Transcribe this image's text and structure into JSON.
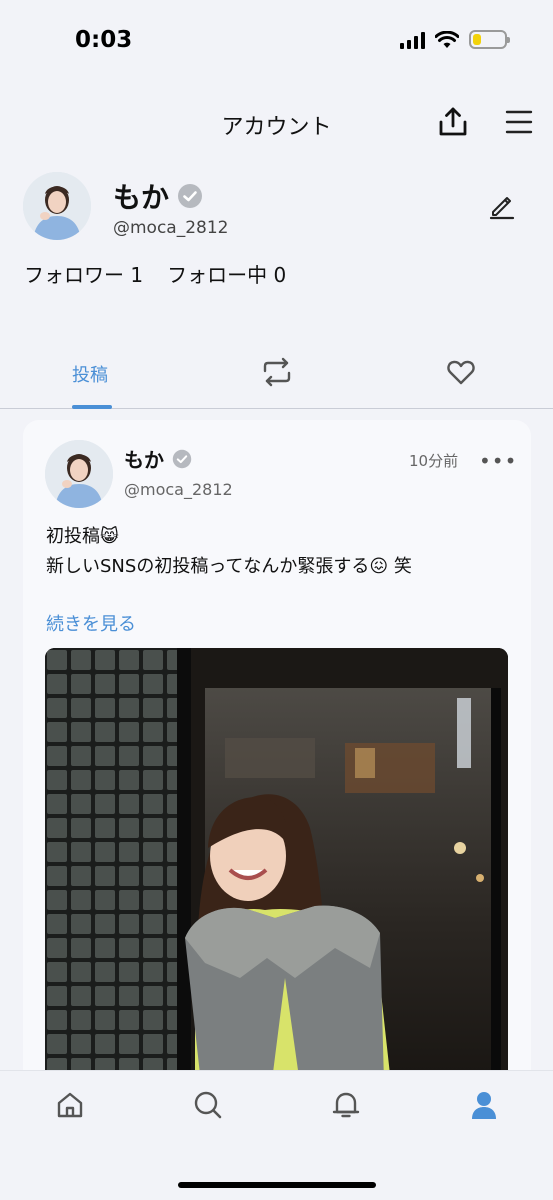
{
  "status_bar": {
    "time": "0:03",
    "battery_level": 0.25
  },
  "header": {
    "title": "アカウント",
    "icons": [
      "share-icon",
      "menu-icon"
    ]
  },
  "profile": {
    "name": "もか",
    "handle": "@moca_2812",
    "followers_label": "フォロワー 1",
    "following_label": "フォロー中 0"
  },
  "tabs": [
    {
      "label": "投稿",
      "active": true
    },
    {
      "icon": "repost-icon"
    },
    {
      "icon": "heart-icon"
    }
  ],
  "post": {
    "author_name": "もか",
    "author_handle": "@moca_2812",
    "time": "10分前",
    "more": "•••",
    "line1": "初投稿😸",
    "line2": "新しいSNSの初投稿ってなんか緊張する😖 笑",
    "read_more": "続きを見る"
  },
  "bottom_nav": [
    {
      "icon": "home-icon"
    },
    {
      "icon": "search-icon"
    },
    {
      "icon": "bell-icon"
    },
    {
      "icon": "profile-icon",
      "active": true
    }
  ],
  "colors": {
    "accent": "#4a8fd6",
    "background": "#f2f3f8",
    "card": "#f8f9fc"
  }
}
